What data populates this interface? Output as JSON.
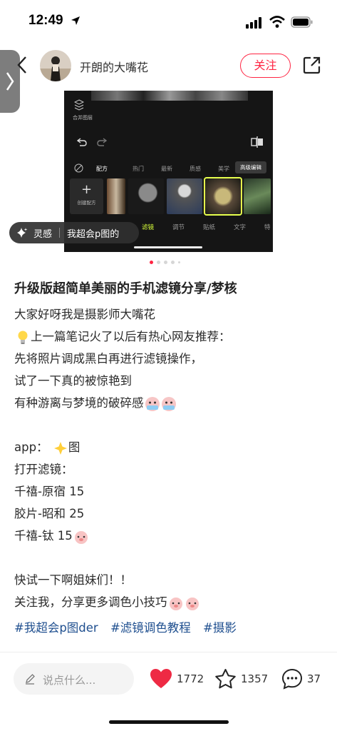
{
  "status_bar": {
    "time": "12:49"
  },
  "header": {
    "username": "开朗的大嘴花",
    "follow_label": "关注"
  },
  "media": {
    "merge_label": "合并图层",
    "categories": [
      "配方",
      "热门",
      "最新",
      "质感",
      "美学"
    ],
    "advanced_edit": "高级编辑",
    "create_label": "创建配方",
    "bottom_tabs": [
      "滤镜",
      "调节",
      "贴纸",
      "文字",
      "特"
    ],
    "slide_count": 5,
    "active_slide": 1
  },
  "inspire_chip": {
    "label": "灵感",
    "query": "我超会p图的"
  },
  "post": {
    "title": "升级版超简单美丽的手机滤镜分享/梦核",
    "lines": [
      "大家好呀我是摄影师大嘴花",
      "上一篇笔记火了以后有热心网友推荐：",
      "先将照片调成黑白再进行滤镜操作，",
      "试了一下真的被惊艳到",
      "有种游离与梦境的破碎感",
      "",
      "app：",
      "打开滤镜：",
      "千禧-原宿 15",
      "胶片-昭和 25",
      "千禧-钛 15",
      "",
      "快试一下啊姐妹们！！",
      "关注我，分享更多调色小技巧"
    ],
    "app_suffix": "图",
    "tags": [
      "#我超会p图der",
      "#滤镜调色教程",
      "#摄影"
    ]
  },
  "bottom_bar": {
    "comment_placeholder": "说点什么...",
    "likes": "1772",
    "favorites": "1357",
    "comments": "37"
  },
  "colors": {
    "accent": "#ff2442",
    "tag": "#1f4f8f"
  },
  "icons": [
    "location-arrow-icon",
    "signal-icon",
    "wifi-icon",
    "battery-icon",
    "back-icon",
    "share-icon",
    "heart-icon",
    "star-icon",
    "comment-icon",
    "pencil-icon",
    "sparkle-icon",
    "lightbulb-icon",
    "star-sparkle-icon",
    "crying-face-icon",
    "pig-face-icon"
  ]
}
